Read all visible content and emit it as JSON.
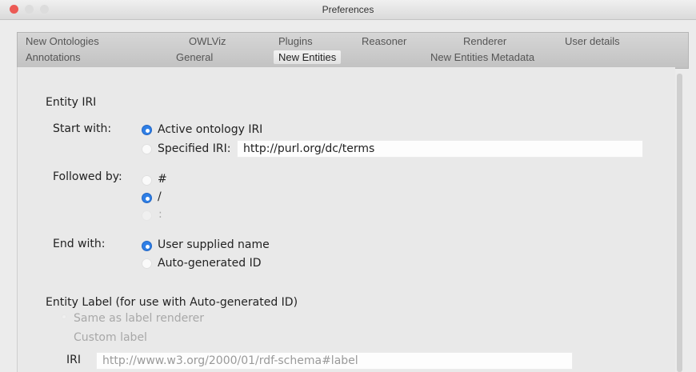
{
  "window": {
    "title": "Preferences"
  },
  "tabs": {
    "row1": [
      "New Ontologies",
      "OWLViz",
      "Plugins",
      "Reasoner",
      "Renderer",
      "User details"
    ],
    "row2": [
      "Annotations",
      "General",
      "New Entities",
      "New Entities Metadata"
    ],
    "selected": "New Entities"
  },
  "entity_iri": {
    "heading": "Entity IRI",
    "start_with": {
      "label": "Start with:",
      "options": [
        "Active ontology IRI",
        "Specified IRI:"
      ],
      "selected": "Active ontology IRI",
      "specified_iri_value": "http://purl.org/dc/terms"
    },
    "followed_by": {
      "label": "Followed by:",
      "options": [
        "#",
        "/",
        ":"
      ],
      "selected": "/"
    },
    "end_with": {
      "label": "End with:",
      "options": [
        "User supplied name",
        "Auto-generated ID"
      ],
      "selected": "User supplied name"
    }
  },
  "entity_label": {
    "heading": "Entity Label (for use with Auto-generated ID)",
    "options": [
      "Same as label renderer",
      "Custom label"
    ],
    "iri_label": "IRI",
    "iri_value": "http://www.w3.org/2000/01/rdf-schema#label"
  }
}
